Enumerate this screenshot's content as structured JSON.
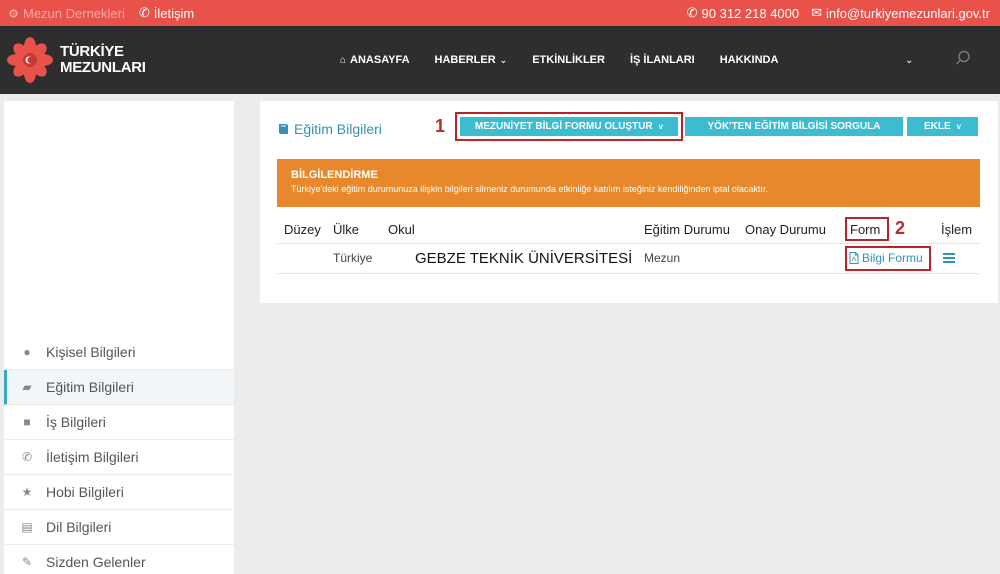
{
  "topbar": {
    "mezun_dernekleri": "Mezun Dernekleri",
    "iletisim": "İletişim",
    "phone": "90 312 218 4000",
    "email": "info@turkiyemezunlari.gov.tr"
  },
  "header": {
    "logo_line1": "TÜRKİYE",
    "logo_line2": "MEZUNLARI",
    "nav": [
      "ANASAYFA",
      "HABERLER",
      "ETKİNLİKLER",
      "İŞ İLANLARI",
      "HAKKINDA"
    ]
  },
  "sidebar": {
    "items": [
      {
        "label": "Kişisel Bilgileri",
        "icon": "user-icon"
      },
      {
        "label": "Eğitim Bilgileri",
        "icon": "book-icon"
      },
      {
        "label": "İş Bilgileri",
        "icon": "briefcase-icon"
      },
      {
        "label": "İletişim Bilgileri",
        "icon": "phone-icon"
      },
      {
        "label": "Hobi Bilgileri",
        "icon": "star-icon"
      },
      {
        "label": "Dil Bilgileri",
        "icon": "language-icon"
      },
      {
        "label": "Sizden Gelenler",
        "icon": "pencil-icon"
      }
    ]
  },
  "content": {
    "title": "Eğitim Bilgileri",
    "mark1": "1",
    "mark2": "2",
    "btn_mezuniyet": "MEZUNİYET BİLGİ FORMU OLUŞTUR",
    "btn_yok": "YÖK'TEN EĞİTİM BİLGİSİ SORGULA",
    "btn_ekle": "EKLE",
    "notice_title": "BİLGİLENDİRME",
    "notice_text": "Türkiye'deki eğitim durumunuza ilişkin bilgileri silmeniz durumunda etkinliğe katılım isteğiniz kendiliğinden iptal olacaktır.",
    "columns": [
      "Düzey",
      "Ülke",
      "Okul",
      "Eğitim Durumu",
      "Onay Durumu",
      "Form",
      "İşlem"
    ],
    "row": {
      "duzey": "",
      "ulke": "Türkiye",
      "okul": "GEBZE TEKNİK ÜNİVERSİTESİ",
      "egitim_durumu": "Mezun",
      "onay_durumu": "",
      "form_link": "Bilgi Formu"
    }
  },
  "colors": {
    "topbar": "#e8524a",
    "header": "#2e2e2e",
    "accent": "#3bbcd0",
    "notice": "#e8882d",
    "highlight": "#b8242a"
  }
}
